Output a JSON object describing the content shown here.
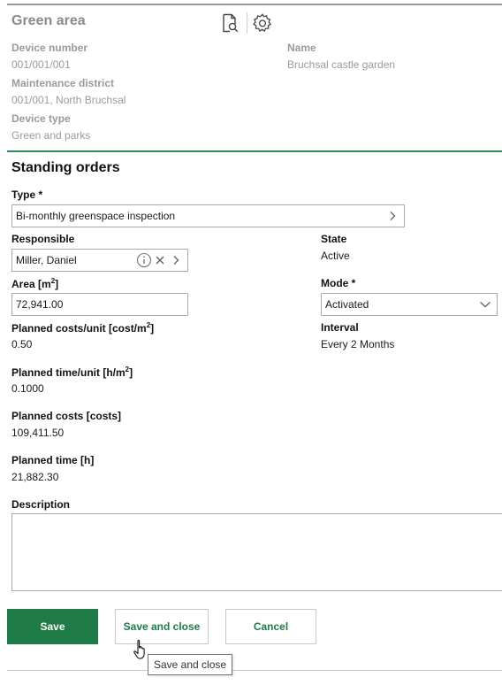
{
  "header": {
    "title": "Green area",
    "preview_icon": "document-search-icon",
    "settings_icon": "gear-icon"
  },
  "general": {
    "device_number_label": "Device number",
    "device_number": "001/001/001",
    "name_label": "Name",
    "name": "Bruchsal castle garden",
    "district_label": "Maintenance district",
    "district": "001/001, North Bruchsal",
    "device_type_label": "Device type",
    "device_type": "Green and parks"
  },
  "standing_orders": {
    "title": "Standing orders",
    "type_label": "Type *",
    "type_value": "Bi-monthly greenspace inspection",
    "responsible_label": "Responsible",
    "responsible_value": "Miller, Daniel",
    "state_label": "State",
    "state_value": "Active",
    "area_label_pre": "Area [m",
    "area_label_sup": "2",
    "area_label_post": "]",
    "area_value": "72,941.00",
    "mode_label": "Mode *",
    "mode_value": "Activated",
    "planned_costs_unit_label_pre": "Planned costs/unit [cost/m",
    "planned_costs_unit_label_sup": "2",
    "planned_costs_unit_label_post": "]",
    "planned_costs_unit_value": "0.50",
    "interval_label": "Interval",
    "interval_value": "Every 2 Months",
    "planned_time_unit_label_pre": "Planned time/unit [h/m",
    "planned_time_unit_label_sup": "2",
    "planned_time_unit_label_post": "]",
    "planned_time_unit_value": "0.1000",
    "planned_costs_label": "Planned costs [costs]",
    "planned_costs_value": "109,411.50",
    "planned_time_label": "Planned time [h]",
    "planned_time_value": "21,882.30",
    "description_label": "Description",
    "description_value": ""
  },
  "buttons": {
    "save": "Save",
    "save_and_close": "Save and close",
    "cancel": "Cancel"
  },
  "tooltip": "Save and close",
  "colors": {
    "accent": "#1e7b45",
    "divider_green": "#2e8b57",
    "muted_text": "#9a9a9a"
  }
}
